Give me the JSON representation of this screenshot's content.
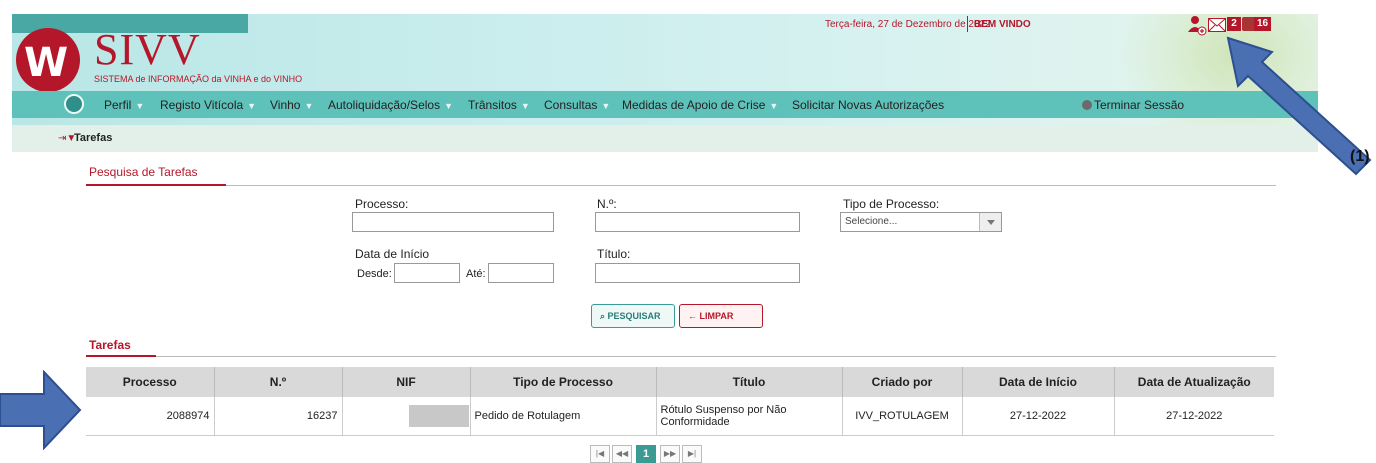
{
  "header": {
    "logo_title": "SIVV",
    "logo_subtitle": "SISTEMA de INFORMAÇÃO da VINHA e do VINHO",
    "date": "Terça-feira, 27 de Dezembro de 2022",
    "welcome": "BEM VINDO",
    "mail_count": "2",
    "alert_count": "16"
  },
  "nav": {
    "items": [
      "Perfil",
      "Registo Vitícola",
      "Vinho",
      "Autoliquidação/Selos",
      "Trânsitos",
      "Consultas",
      "Medidas de Apoio de Crise",
      "Solicitar Novas Autorizações"
    ],
    "logout": "Terminar Sessão"
  },
  "breadcrumb": {
    "current": "Tarefas"
  },
  "search": {
    "title": "Pesquisa de Tarefas",
    "processo_label": "Processo:",
    "numero_label": "N.º:",
    "tipo_label": "Tipo de Processo:",
    "tipo_selected": "Selecione...",
    "data_inicio_label": "Data de Início",
    "desde_label": "Desde:",
    "ate_label": "Até:",
    "titulo_label": "Título:",
    "search_button": "PESQUISAR",
    "clear_button": "LIMPAR"
  },
  "tasks": {
    "title": "Tarefas",
    "columns": [
      "Processo",
      "N.º",
      "NIF",
      "Tipo de Processo",
      "Título",
      "Criado por",
      "Data de Início",
      "Data de Atualização"
    ],
    "rows": [
      {
        "processo": "2088974",
        "numero": "16237",
        "nif": "",
        "tipo": "Pedido de Rotulagem",
        "titulo": "Rótulo Suspenso por Não Conformidade",
        "criado_por": "IVV_ROTULAGEM",
        "data_inicio": "27-12-2022",
        "data_atualizacao": "27-12-2022"
      }
    ]
  },
  "pager": {
    "current_page": "1"
  },
  "annotation": {
    "marker": "(1)"
  },
  "colors": {
    "brand": "#b5172a",
    "nav": "#5ec1ba",
    "accent": "#3a9a94"
  }
}
